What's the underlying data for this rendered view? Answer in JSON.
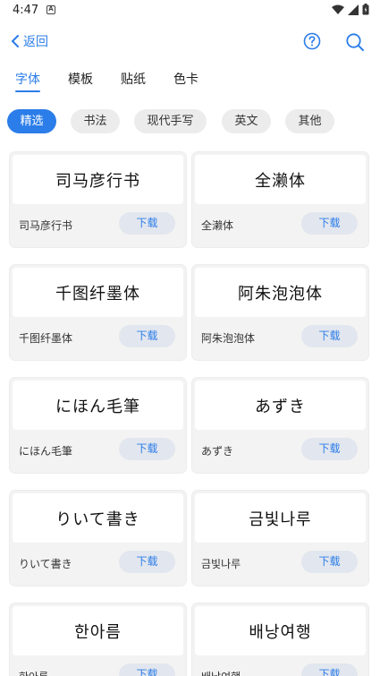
{
  "status_bar": {
    "time": "4:47"
  },
  "header": {
    "back_label": "返回"
  },
  "tabs": [
    {
      "label": "字体",
      "active": true
    },
    {
      "label": "模板",
      "active": false
    },
    {
      "label": "贴纸",
      "active": false
    },
    {
      "label": "色卡",
      "active": false
    }
  ],
  "filters": [
    {
      "label": "精选",
      "active": true
    },
    {
      "label": "书法",
      "active": false
    },
    {
      "label": "现代手写",
      "active": false
    },
    {
      "label": "英文",
      "active": false
    },
    {
      "label": "其他",
      "active": false
    }
  ],
  "fonts": [
    {
      "preview": "司马彦行书",
      "name": "司马彦行书",
      "download_label": "下载"
    },
    {
      "preview": "全濑体",
      "name": "全濑体",
      "download_label": "下载"
    },
    {
      "preview": "千图纤墨体",
      "name": "千图纤墨体",
      "download_label": "下载"
    },
    {
      "preview": "阿朱泡泡体",
      "name": "阿朱泡泡体",
      "download_label": "下载"
    },
    {
      "preview": "にほん毛筆",
      "name": "にほん毛筆",
      "download_label": "下载"
    },
    {
      "preview": "あずき",
      "name": "あずき",
      "download_label": "下载"
    },
    {
      "preview": "りいて書き",
      "name": "りいて書き",
      "download_label": "下载"
    },
    {
      "preview": "금빛나루",
      "name": "금빛나루",
      "download_label": "下载"
    },
    {
      "preview": "한아름",
      "name": "한아름",
      "download_label": "下载"
    },
    {
      "preview": "배낭여행",
      "name": "배낭여행",
      "download_label": "下载"
    }
  ],
  "colors": {
    "accent": "#2b7de9",
    "chip_bg": "#ececec",
    "card_bg": "#f3f3f3",
    "button_bg": "#e2e6ee"
  }
}
